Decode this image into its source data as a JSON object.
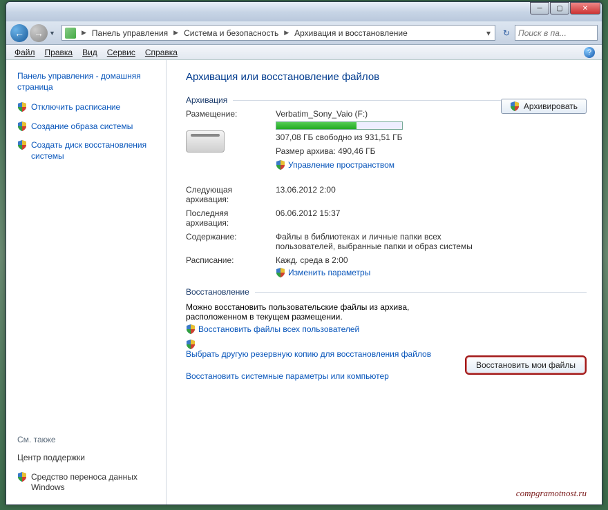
{
  "titlebar": {},
  "breadcrumb": {
    "a": "Панель управления",
    "b": "Система и безопасность",
    "c": "Архивация и восстановление"
  },
  "search": {
    "ph": "Поиск в па..."
  },
  "menu": {
    "file": "Файл",
    "edit": "Правка",
    "view": "Вид",
    "service": "Сервис",
    "help": "Справка"
  },
  "sidebar": {
    "home": "Панель управления - домашняя страница",
    "i1": "Отключить расписание",
    "i2": "Создание образа системы",
    "i3": "Создать диск восстановления системы",
    "see": "См. также",
    "s1": "Центр поддержки",
    "s2": "Средство переноса данных Windows"
  },
  "main": {
    "title": "Архивация или восстановление файлов",
    "g1": "Архивация",
    "loc_l": "Размещение:",
    "loc_v": "Verbatim_Sony_Vaio (F:)",
    "free": "307,08 ГБ свободно из 931,51 ГБ",
    "size": "Размер архива: 490,46 ГБ",
    "manage": "Управление пространством",
    "next_l": "Следующая архивация:",
    "next_v": "13.06.2012 2:00",
    "last_l": "Последняя архивация:",
    "last_v": "06.06.2012 15:37",
    "cont_l": "Содержание:",
    "cont_v": "Файлы в библиотеках и личные папки всех пользователей, выбранные папки и образ системы",
    "sched_l": "Расписание:",
    "sched_v": "Кажд. среда в 2:00",
    "change": "Изменить параметры",
    "btn_arch": "Архивировать",
    "g2": "Восстановление",
    "rest_t": "Можно восстановить пользовательские файлы из архива, расположенном в текущем размещении.",
    "rest_all": "Восстановить файлы всех пользователей",
    "rest_other": "Выбрать другую резервную копию для восстановления файлов",
    "rest_sys": "Восстановить системные параметры или компьютер",
    "btn_rest": "Восстановить мои файлы",
    "wm": "compgramotnost.ru"
  }
}
